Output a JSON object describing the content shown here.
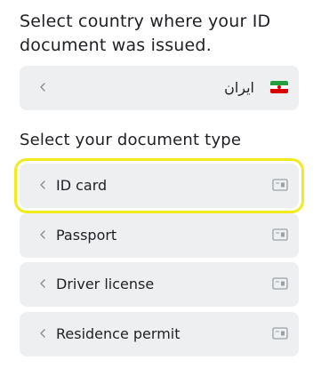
{
  "country_section": {
    "heading": "Select country where your ID document was issued.",
    "selected_country": {
      "name": "ایران",
      "flag_icon": "iran-flag-icon"
    }
  },
  "document_section": {
    "heading": "Select your document type",
    "options": [
      {
        "label": "ID card",
        "icon": "id-card-icon",
        "selected": true
      },
      {
        "label": "Passport",
        "icon": "id-card-icon",
        "selected": false
      },
      {
        "label": "Driver license",
        "icon": "id-card-icon",
        "selected": false
      },
      {
        "label": "Residence permit",
        "icon": "id-card-icon",
        "selected": false
      }
    ]
  },
  "colors": {
    "row_background": "#eeeff1",
    "selection_highlight": "#f2ea1b",
    "icon_gray": "#9aa0a6"
  }
}
